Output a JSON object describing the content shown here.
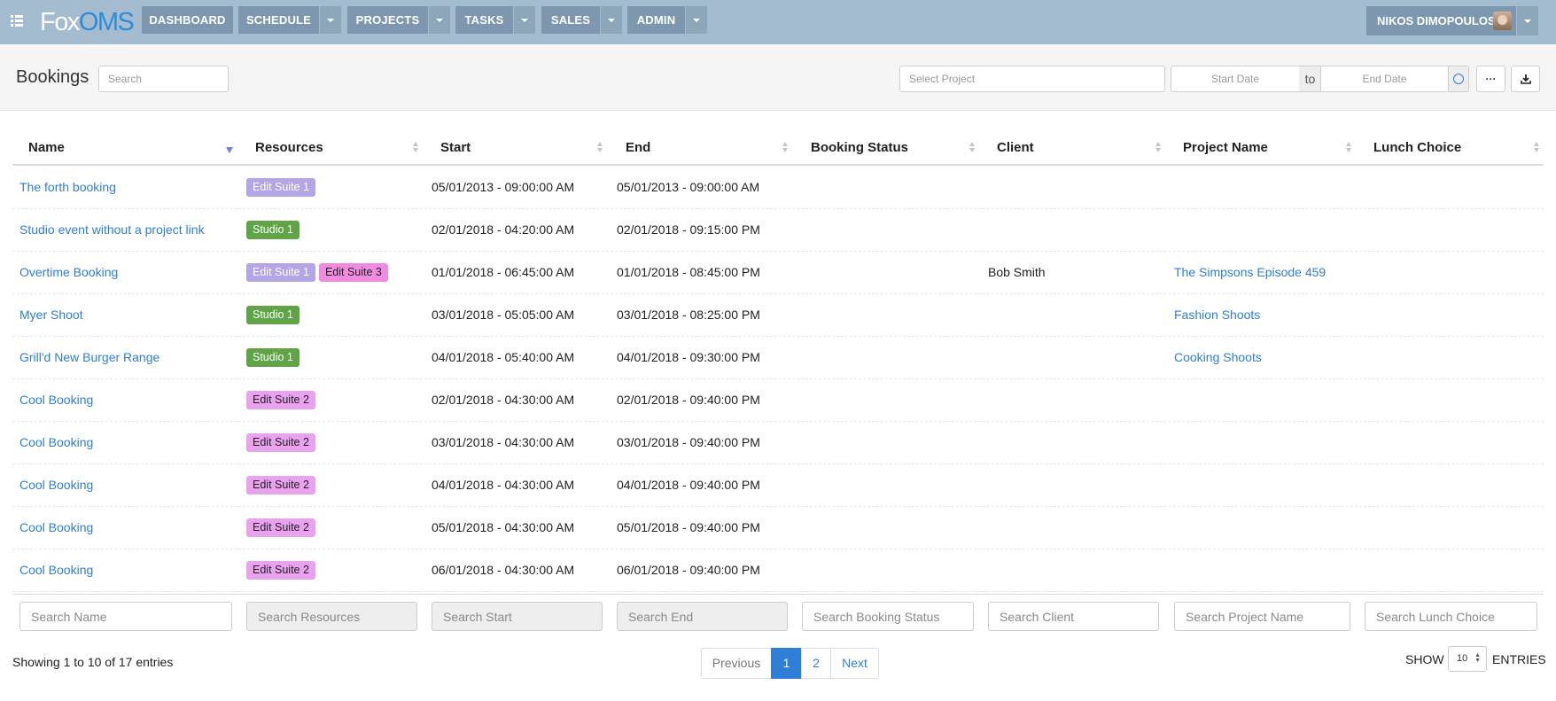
{
  "app": {
    "logo_part1": "Fox",
    "logo_part2": "OMS"
  },
  "nav": {
    "items": [
      {
        "label": "DASHBOARD",
        "has_dropdown": false
      },
      {
        "label": "SCHEDULE",
        "has_dropdown": true
      },
      {
        "label": "PROJECTS",
        "has_dropdown": true
      },
      {
        "label": "TASKS",
        "has_dropdown": true
      },
      {
        "label": "SALES",
        "has_dropdown": true
      },
      {
        "label": "ADMIN",
        "has_dropdown": true
      }
    ],
    "user_name": "NIKOS DIMOPOULOS"
  },
  "toolbar": {
    "title": "Bookings",
    "search_placeholder": "Search",
    "project_placeholder": "Select Project",
    "start_date_placeholder": "Start Date",
    "to_label": "to",
    "end_date_placeholder": "End Date",
    "more_label": "···",
    "download_icon": "download-icon",
    "clear_icon": "clear-circle-icon"
  },
  "table": {
    "columns": [
      "Name",
      "Resources",
      "Start",
      "End",
      "Booking Status",
      "Client",
      "Project Name",
      "Lunch Choice"
    ],
    "sorted_column": "Name",
    "rows": [
      {
        "name": "The forth booking",
        "resources": [
          {
            "label": "Edit Suite 1",
            "bg": "#b3a5e6",
            "fg": "#ffffff"
          }
        ],
        "start": "05/01/2013 - 09:00:00 AM",
        "end": "05/01/2013 - 09:00:00 AM",
        "status": "",
        "client": "",
        "project": "",
        "lunch": ""
      },
      {
        "name": "Studio event without a project link",
        "resources": [
          {
            "label": "Studio 1",
            "bg": "#5fa548",
            "fg": "#ffffff"
          }
        ],
        "start": "02/01/2018 - 04:20:00 AM",
        "end": "02/01/2018 - 09:15:00 PM",
        "status": "",
        "client": "",
        "project": "",
        "lunch": ""
      },
      {
        "name": "Overtime Booking",
        "resources": [
          {
            "label": "Edit Suite 1",
            "bg": "#b3a5e6",
            "fg": "#ffffff"
          },
          {
            "label": "Edit Suite 3",
            "bg": "#f08ce0",
            "fg": "#222222"
          }
        ],
        "start": "01/01/2018 - 06:45:00 AM",
        "end": "01/01/2018 - 08:45:00 PM",
        "status": "",
        "client": "Bob Smith",
        "project": "The Simpsons Episode 459",
        "lunch": ""
      },
      {
        "name": "Myer Shoot",
        "resources": [
          {
            "label": "Studio 1",
            "bg": "#5fa548",
            "fg": "#ffffff"
          }
        ],
        "start": "03/01/2018 - 05:05:00 AM",
        "end": "03/01/2018 - 08:25:00 PM",
        "status": "",
        "client": "",
        "project": "Fashion Shoots",
        "lunch": ""
      },
      {
        "name": "Grill'd New Burger Range",
        "resources": [
          {
            "label": "Studio 1",
            "bg": "#5fa548",
            "fg": "#ffffff"
          }
        ],
        "start": "04/01/2018 - 05:40:00 AM",
        "end": "04/01/2018 - 09:30:00 PM",
        "status": "",
        "client": "",
        "project": "Cooking Shoots",
        "lunch": ""
      },
      {
        "name": "Cool Booking",
        "resources": [
          {
            "label": "Edit Suite 2",
            "bg": "#e9a3ee",
            "fg": "#222222"
          }
        ],
        "start": "02/01/2018 - 04:30:00 AM",
        "end": "02/01/2018 - 09:40:00 PM",
        "status": "",
        "client": "",
        "project": "",
        "lunch": ""
      },
      {
        "name": "Cool Booking",
        "resources": [
          {
            "label": "Edit Suite 2",
            "bg": "#e9a3ee",
            "fg": "#222222"
          }
        ],
        "start": "03/01/2018 - 04:30:00 AM",
        "end": "03/01/2018 - 09:40:00 PM",
        "status": "",
        "client": "",
        "project": "",
        "lunch": ""
      },
      {
        "name": "Cool Booking",
        "resources": [
          {
            "label": "Edit Suite 2",
            "bg": "#e9a3ee",
            "fg": "#222222"
          }
        ],
        "start": "04/01/2018 - 04:30:00 AM",
        "end": "04/01/2018 - 09:40:00 PM",
        "status": "",
        "client": "",
        "project": "",
        "lunch": ""
      },
      {
        "name": "Cool Booking",
        "resources": [
          {
            "label": "Edit Suite 2",
            "bg": "#e9a3ee",
            "fg": "#222222"
          }
        ],
        "start": "05/01/2018 - 04:30:00 AM",
        "end": "05/01/2018 - 09:40:00 PM",
        "status": "",
        "client": "",
        "project": "",
        "lunch": ""
      },
      {
        "name": "Cool Booking",
        "resources": [
          {
            "label": "Edit Suite 2",
            "bg": "#e9a3ee",
            "fg": "#222222"
          }
        ],
        "start": "06/01/2018 - 04:30:00 AM",
        "end": "06/01/2018 - 09:40:00 PM",
        "status": "",
        "client": "",
        "project": "",
        "lunch": ""
      }
    ],
    "filters": [
      {
        "placeholder": "Search Name",
        "disabled": false
      },
      {
        "placeholder": "Search Resources",
        "disabled": true
      },
      {
        "placeholder": "Search Start",
        "disabled": true
      },
      {
        "placeholder": "Search End",
        "disabled": true
      },
      {
        "placeholder": "Search Booking Status",
        "disabled": false
      },
      {
        "placeholder": "Search Client",
        "disabled": false
      },
      {
        "placeholder": "Search Project Name",
        "disabled": false
      },
      {
        "placeholder": "Search Lunch Choice",
        "disabled": false
      }
    ]
  },
  "footer": {
    "info": "Showing 1 to 10 of 17 entries",
    "previous_label": "Previous",
    "pages": [
      "1",
      "2"
    ],
    "active_page": "1",
    "next_label": "Next",
    "show_label": "SHOW",
    "page_length": "10",
    "entries_label": "ENTRIES"
  },
  "colors": {
    "navbar_bg": "#a3bcd0",
    "nav_button_bg": "#7d98ae",
    "link": "#2f7ed8",
    "sort_active": "#7b7fe3"
  }
}
